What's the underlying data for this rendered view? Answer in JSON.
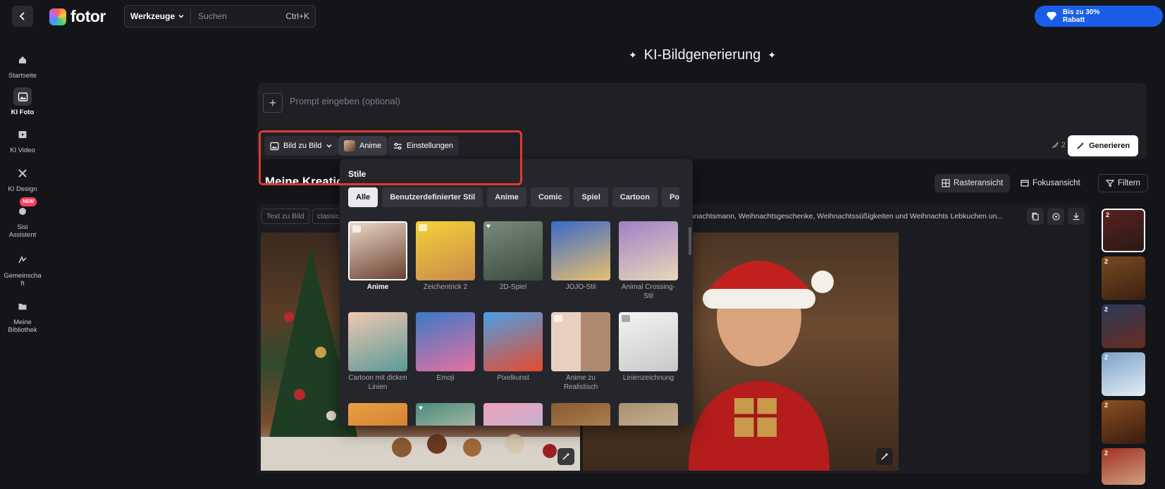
{
  "topbar": {
    "logo_text": "fotor",
    "tools_label": "Werkzeuge",
    "search_placeholder": "Suchen",
    "search_shortcut": "Ctrl+K",
    "promo_line1": "Bis zu 30%",
    "promo_line2": "Rabatt"
  },
  "sidebar": {
    "items": [
      {
        "label": "Startseite",
        "icon": "home-icon"
      },
      {
        "label": "KI Foto",
        "icon": "image-icon",
        "active": true
      },
      {
        "label": "KI Video",
        "icon": "video-icon"
      },
      {
        "label": "KI Design",
        "icon": "design-icon"
      },
      {
        "label": "Sisi Assistent",
        "icon": "assistant-icon",
        "badge": "NEW"
      },
      {
        "label": "Gemeinschaft",
        "icon": "community-icon"
      },
      {
        "label": "Meine Bibliothek",
        "icon": "folder-icon"
      }
    ]
  },
  "page": {
    "title": "KI-Bildgenerierung"
  },
  "prompt": {
    "placeholder": "Prompt eingeben (optional)",
    "mode_label": "Bild zu Bild",
    "style_label": "Anime",
    "settings_label": "Einstellungen",
    "credit_count": "2",
    "generate_label": "Generieren"
  },
  "section": {
    "title": "Meine Kreationen",
    "grid_view_label": "Rasteransicht",
    "focus_view_label": "Fokusansicht",
    "filter_label": "Filtern"
  },
  "gallery": {
    "tags": [
      "Text zu Bild",
      "classic"
    ],
    "prompt_text": "hnachtsmann, Weihnachtsgeschenke, Weihnachtssüßigkeiten und Weihnachts Lebkuchen un..."
  },
  "thumbnails": {
    "count_label": "2"
  },
  "style_dropdown": {
    "title": "Stile",
    "filters": [
      "Alle",
      "Benutzerdefinierter Stil",
      "Anime",
      "Comic",
      "Spiel",
      "Cartoon",
      "Porträt"
    ],
    "active_filter": "Alle",
    "styles": [
      {
        "label": "Anime",
        "selected": true
      },
      {
        "label": "Zeichentrick 2"
      },
      {
        "label": "2D-Spiel"
      },
      {
        "label": "JOJO-Stil"
      },
      {
        "label": "Animal Crossing-Stil"
      },
      {
        "label": "Cartoon mit dicken Linien"
      },
      {
        "label": "Emoji"
      },
      {
        "label": "Pixelkunst"
      },
      {
        "label": "Anime zu Realistisch"
      },
      {
        "label": "Linienzeichnung"
      }
    ]
  },
  "colors": {
    "background": "#141519",
    "accent_blue": "#1a5ee8",
    "highlight_red": "#e03a2f"
  }
}
